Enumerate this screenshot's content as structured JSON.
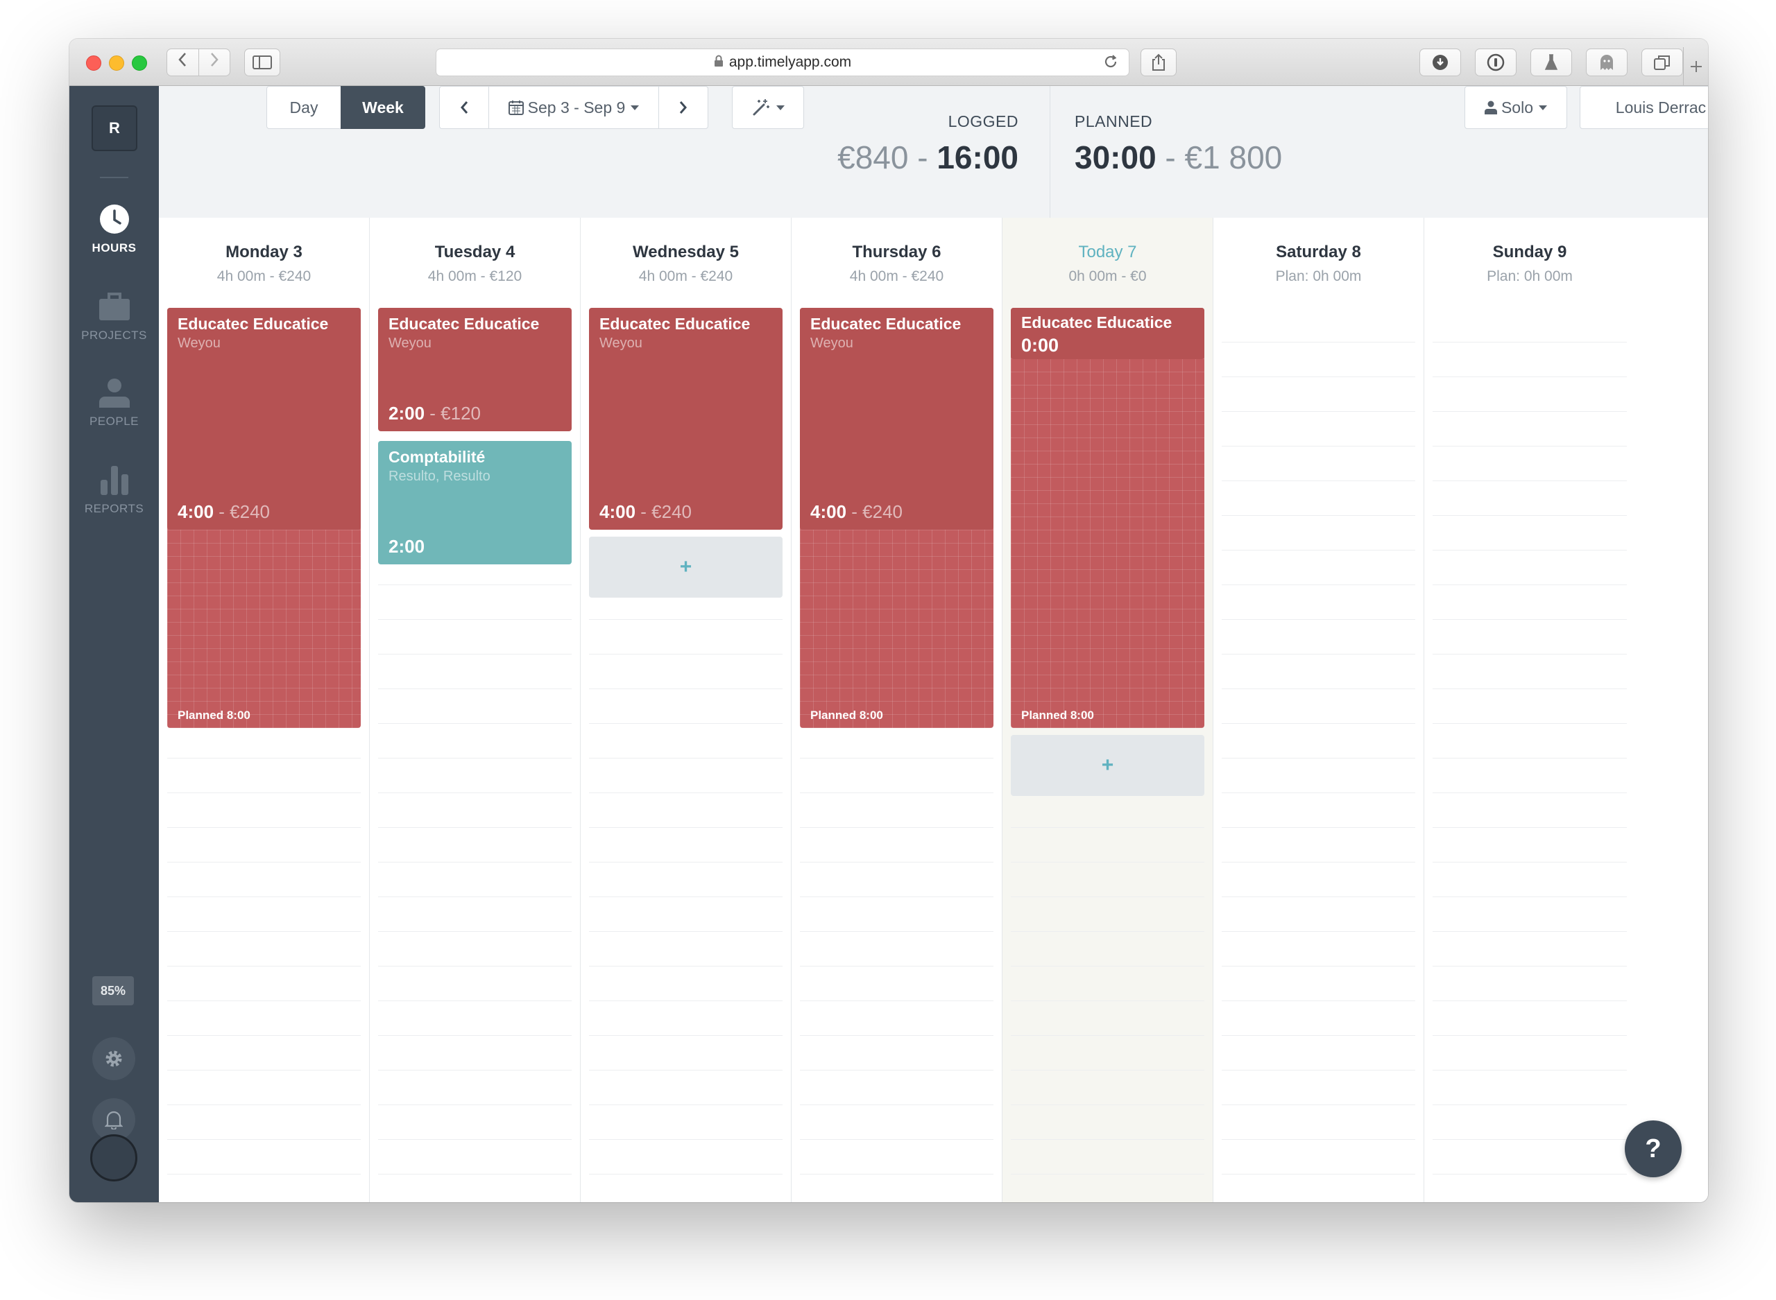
{
  "browser": {
    "url": "app.timelyapp.com"
  },
  "sidebar": {
    "workspace_initial": "R",
    "nav": [
      {
        "label": "HOURS",
        "icon": "clock-icon",
        "active": true
      },
      {
        "label": "PROJECTS",
        "icon": "briefcase-icon",
        "active": false
      },
      {
        "label": "PEOPLE",
        "icon": "person-icon",
        "active": false
      },
      {
        "label": "REPORTS",
        "icon": "bar-chart-icon",
        "active": false
      }
    ],
    "progress_label": "85%",
    "progress_value": 0.85
  },
  "toolbar": {
    "view_day": "Day",
    "view_week": "Week",
    "active_view": "Week",
    "date_range": "Sep 3 - Sep 9",
    "logged_label": "LOGGED",
    "logged_amount": "€840",
    "logged_sep": " - ",
    "logged_hours": "16:00",
    "planned_label": "PLANNED",
    "planned_hours": "30:00",
    "planned_sep": " - ",
    "planned_amount": "€1 800",
    "team_filter": "Solo",
    "user_filter": "Louis Derrac"
  },
  "days": [
    {
      "name": "Monday 3",
      "summary": "4h 00m - €240",
      "entries": [
        {
          "title": "Educatec Educatice",
          "subtitle": "Weyou",
          "time": "4:00",
          "cost": " - €240"
        }
      ],
      "planned_label": "Planned 8:00"
    },
    {
      "name": "Tuesday 4",
      "summary": "4h 00m - €120",
      "entries": [
        {
          "title": "Educatec Educatice",
          "subtitle": "Weyou",
          "time": "2:00",
          "cost": " - €120"
        },
        {
          "title": "Comptabilité",
          "subtitle": "Resulto, Resulto",
          "time": "2:00"
        }
      ]
    },
    {
      "name": "Wednesday 5",
      "summary": "4h 00m - €240",
      "entries": [
        {
          "title": "Educatec Educatice",
          "subtitle": "Weyou",
          "time": "4:00",
          "cost": " - €240"
        }
      ],
      "add_label": "+"
    },
    {
      "name": "Thursday 6",
      "summary": "4h 00m - €240",
      "entries": [
        {
          "title": "Educatec Educatice",
          "subtitle": "Weyou",
          "time": "4:00",
          "cost": " - €240"
        }
      ],
      "planned_label": "Planned 8:00"
    },
    {
      "name": "Today 7",
      "summary": "0h 00m - €0",
      "entries": [
        {
          "title": "Educatec Educatice",
          "time": "0:00"
        }
      ],
      "planned_label": "Planned 8:00",
      "add_label": "+"
    },
    {
      "name": "Saturday 8",
      "summary": "Plan: 0h 00m"
    },
    {
      "name": "Sunday 9",
      "summary": "Plan: 0h 00m"
    }
  ],
  "help_label": "?",
  "colors": {
    "entry_red": "#b55253",
    "planned_red": "#c25b5e",
    "entry_teal": "#70b7b8",
    "accent_teal": "#5fb2c0",
    "sidebar": "#3e4a57"
  }
}
